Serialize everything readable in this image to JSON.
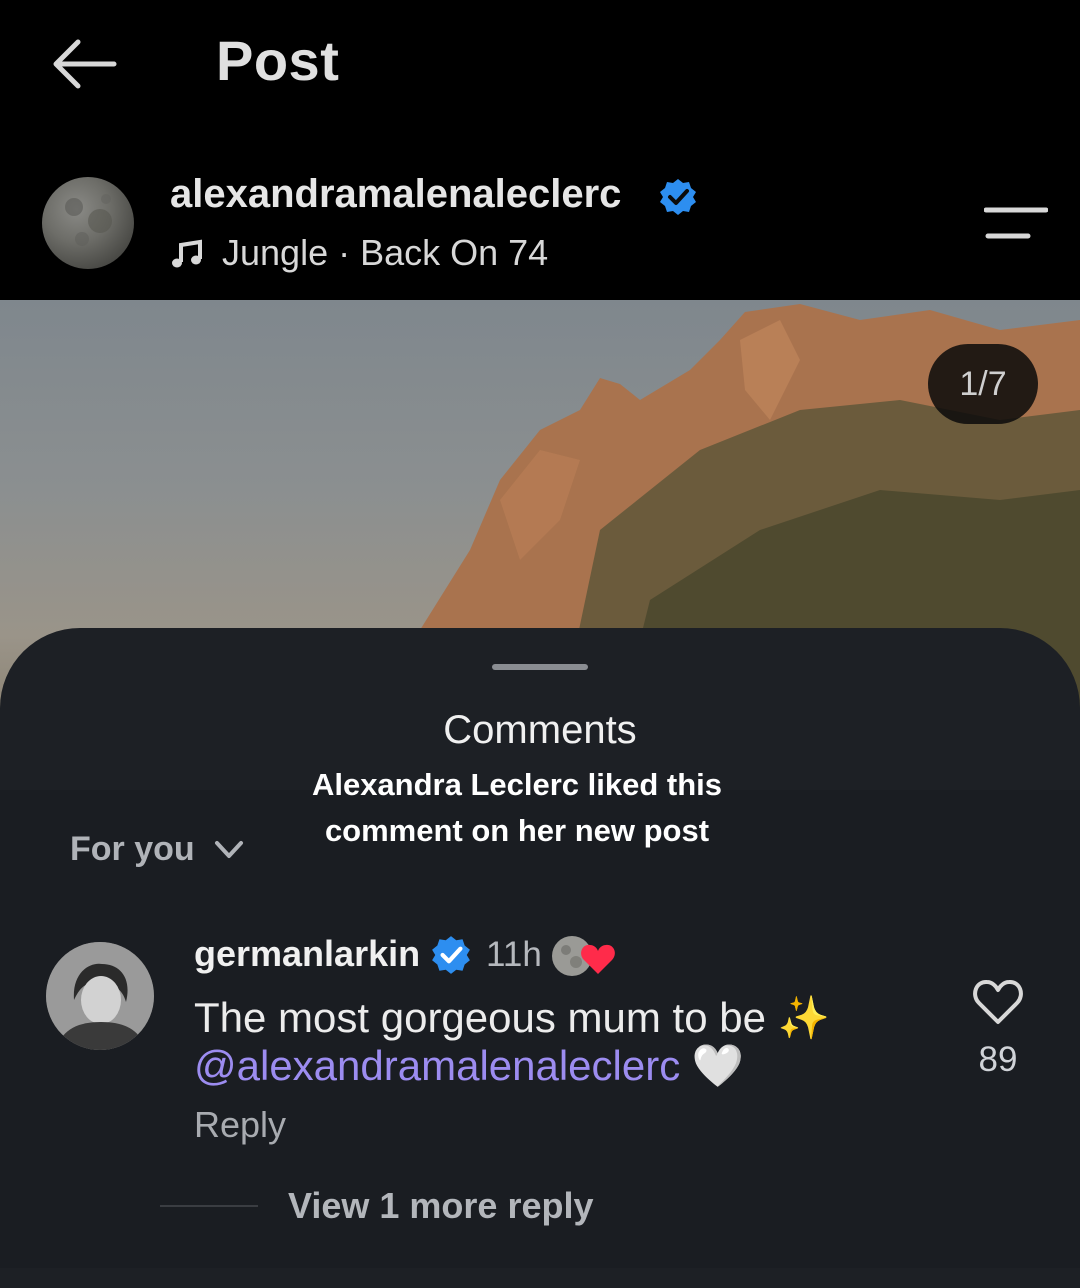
{
  "header": {
    "title": "Post"
  },
  "post": {
    "author": "alexandramalenaleclerc",
    "audio": "Jungle · Back On 74",
    "pager": "1/7"
  },
  "sheet": {
    "title": "Comments",
    "caption": "Alexandra Leclerc liked this comment on her new post",
    "sort_label": "For you"
  },
  "comment": {
    "username": "germanlarkin",
    "time": "11h",
    "text": "The most gorgeous mum to be ✨",
    "mention": "@alexandramalenaleclerc",
    "emoji": "🤍",
    "reply_label": "Reply",
    "likes": "89",
    "view_more": "View 1 more reply"
  },
  "colors": {
    "verified": "#2d8ef0",
    "mention": "#9c8cf0",
    "heart": "#ff2b4a",
    "sheet": "#1d2025"
  }
}
